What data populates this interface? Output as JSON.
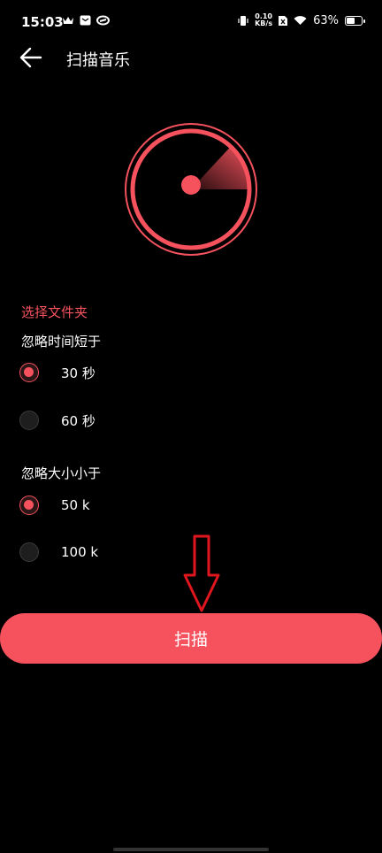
{
  "status_bar": {
    "time": "15:03",
    "net_speed_value": "0.10",
    "net_speed_unit": "KB/s",
    "battery": "63%",
    "battery_level": 0.63,
    "left_icons": [
      "crown-icon",
      "message-icon",
      "sync-icon"
    ],
    "right_icons": [
      "vibrate-icon",
      "sim-icon",
      "wifi-icon",
      "battery-icon"
    ]
  },
  "header": {
    "title": "扫描音乐",
    "back_icon": "arrow-left-icon"
  },
  "settings": {
    "folder_label": "选择文件夹",
    "duration": {
      "label": "忽略时间短于",
      "options": [
        {
          "label": "30 秒",
          "checked": true
        },
        {
          "label": "60 秒",
          "checked": false
        }
      ]
    },
    "size": {
      "label": "忽略大小小于",
      "options": [
        {
          "label": "50 k",
          "checked": true
        },
        {
          "label": "100 k",
          "checked": false
        }
      ]
    }
  },
  "scan_button": {
    "label": "扫描"
  },
  "colors": {
    "accent": "#f5525e",
    "background": "#000000",
    "annotation_arrow": "#e0161e"
  }
}
